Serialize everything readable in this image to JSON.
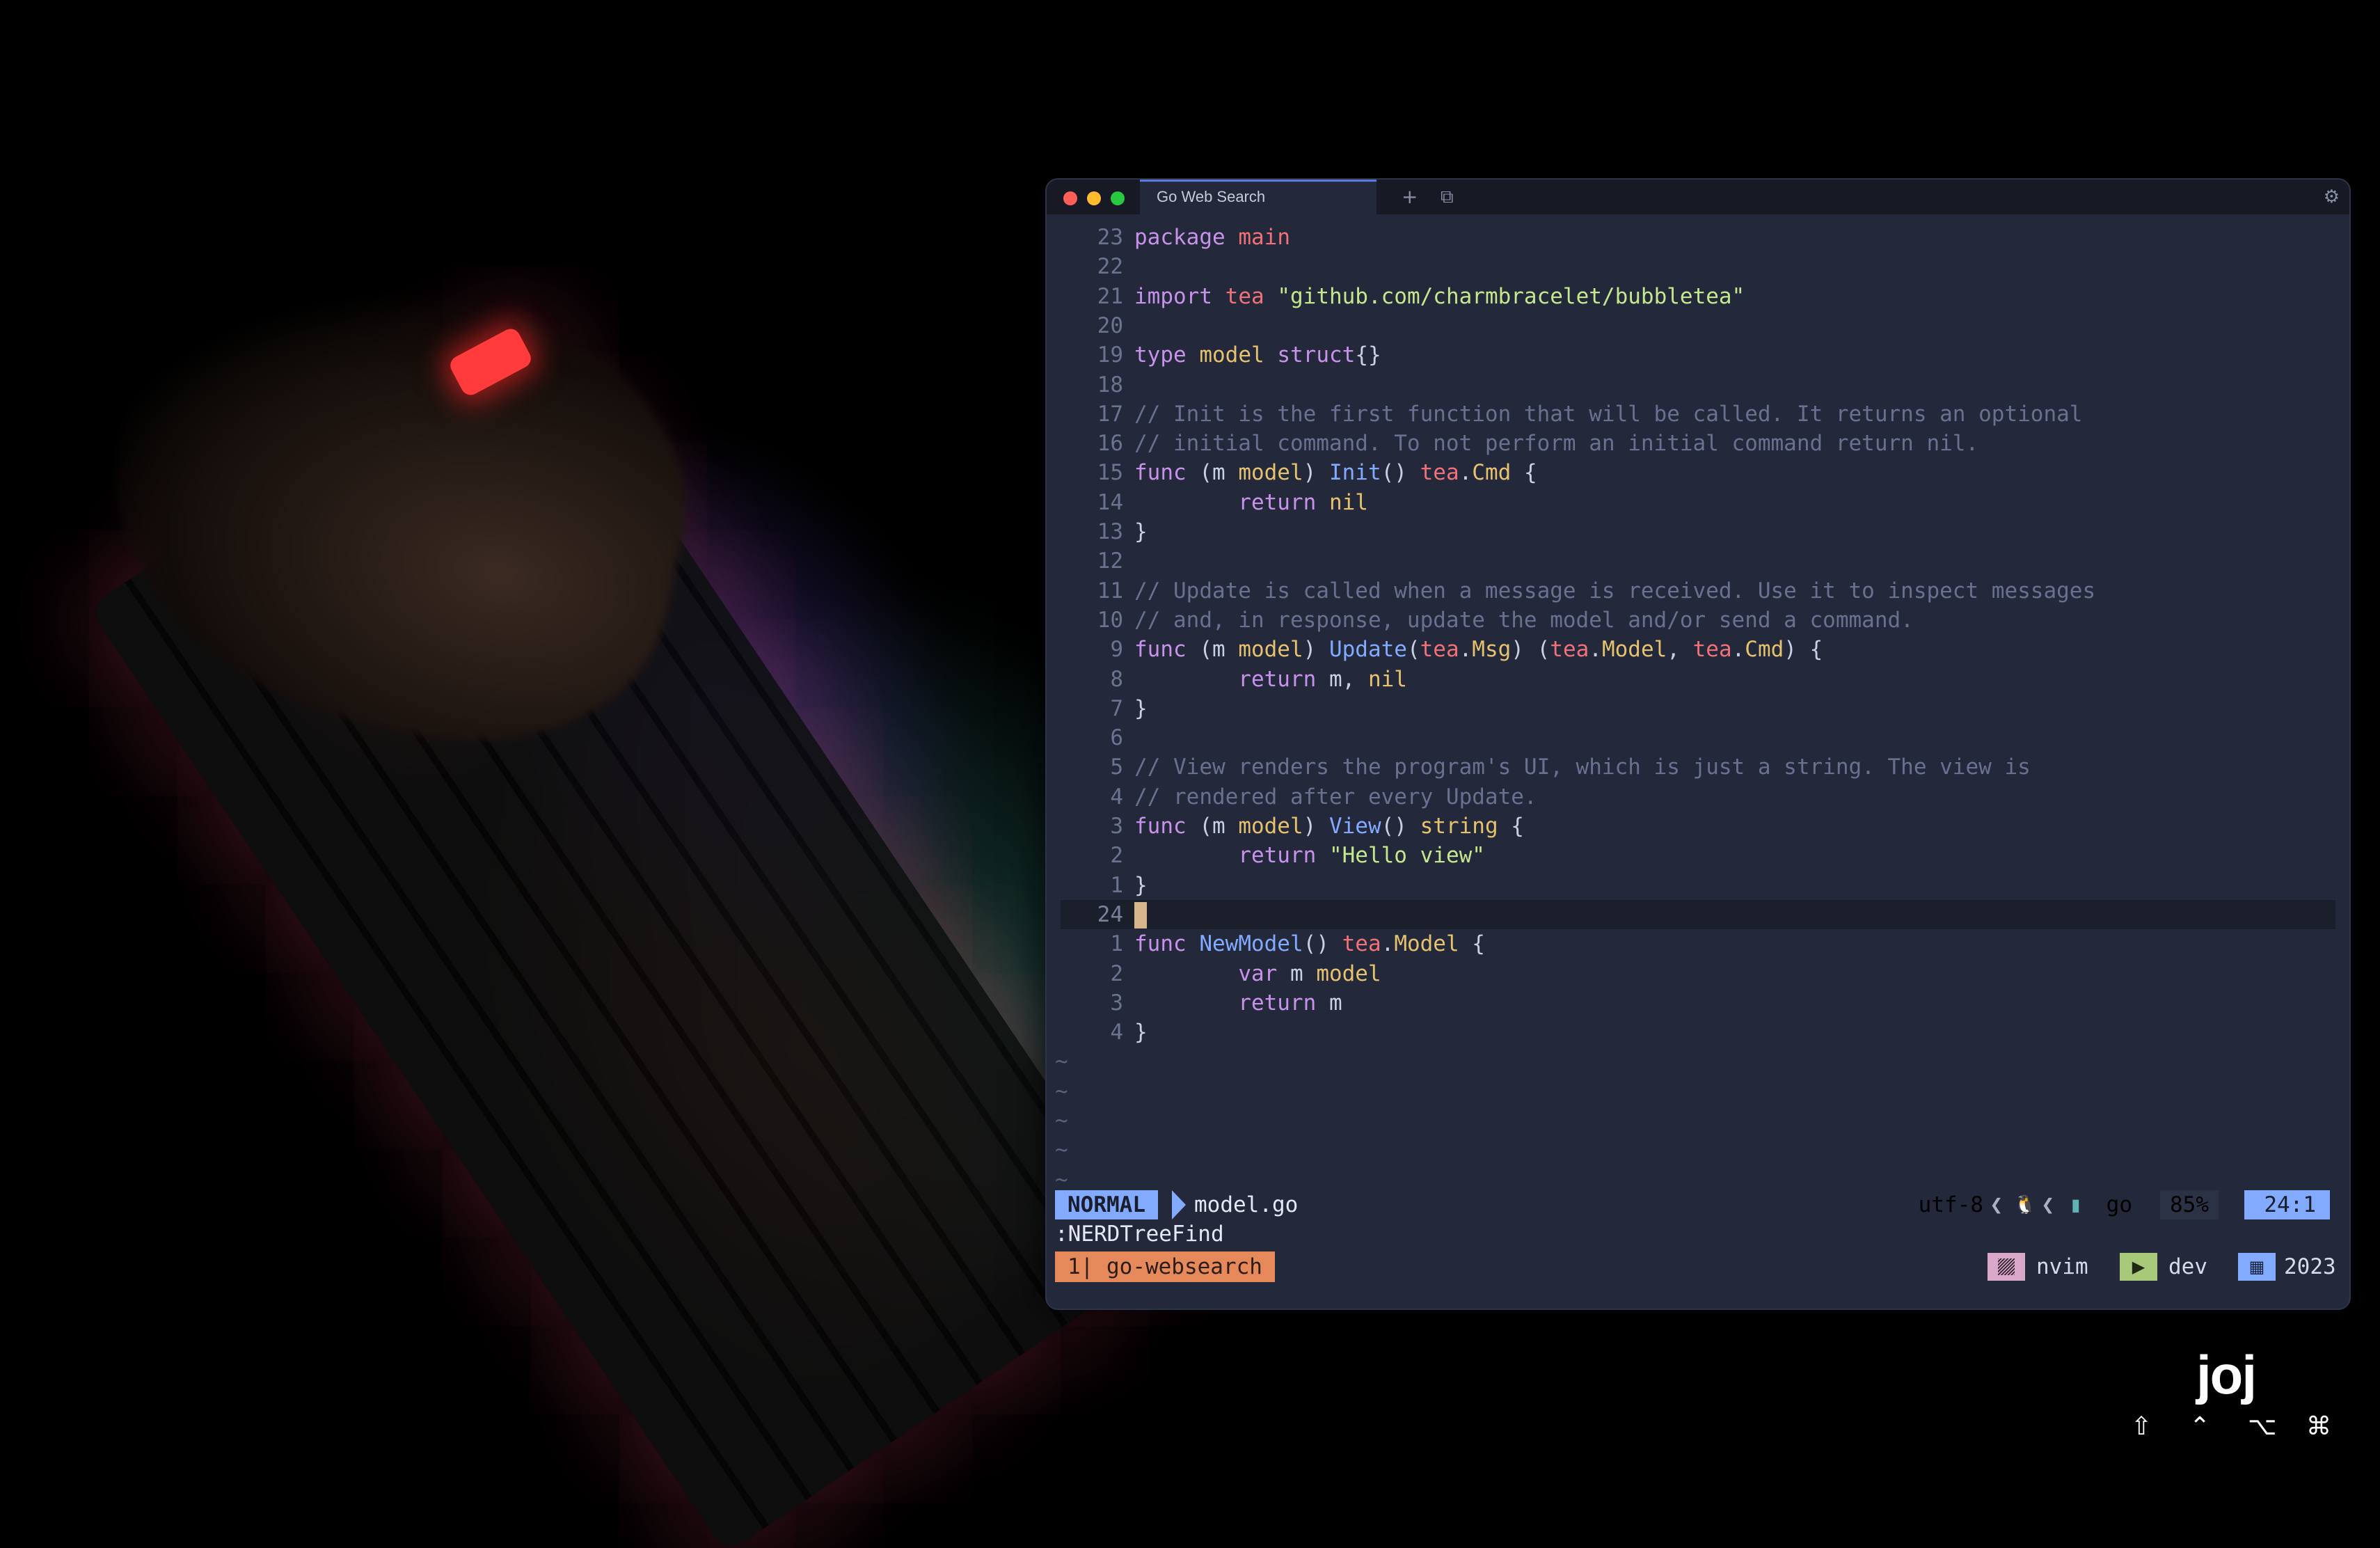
{
  "window": {
    "tab_title": "Go Web Search",
    "new_tab_icon": "+",
    "duplicate_icon": "⧉",
    "settings_icon": "⚙"
  },
  "editor": {
    "lines": [
      {
        "num": "23",
        "html": "<span class=\"kw\">package</span> <span class=\"pk\">main</span>"
      },
      {
        "num": "22",
        "html": ""
      },
      {
        "num": "21",
        "html": "<span class=\"kw\">import</span> <span class=\"pk\">tea</span> <span class=\"st\">\"github.com/charmbracelet/bubbletea\"</span>"
      },
      {
        "num": "20",
        "html": ""
      },
      {
        "num": "19",
        "html": "<span class=\"kw\">type</span> <span class=\"ty\">model</span> <span class=\"kw\">struct</span><span class=\"df\">{}</span>"
      },
      {
        "num": "18",
        "html": ""
      },
      {
        "num": "17",
        "html": "<span class=\"cm\">// Init is the first function that will be called. It returns an optional</span>"
      },
      {
        "num": "16",
        "html": "<span class=\"cm\">// initial command. To not perform an initial command return nil.</span>"
      },
      {
        "num": "15",
        "html": "<span class=\"kw\">func</span> (m <span class=\"ty\">model</span>) <span class=\"fn\">Init</span>() <span class=\"pk\">tea</span>.<span class=\"ty\">Cmd</span> {"
      },
      {
        "num": "14",
        "html": "        <span class=\"kw\">return</span> <span class=\"ty\">nil</span>"
      },
      {
        "num": "13",
        "html": "}"
      },
      {
        "num": "12",
        "html": ""
      },
      {
        "num": "11",
        "html": "<span class=\"cm\">// Update is called when a message is received. Use it to inspect messages</span>"
      },
      {
        "num": "10",
        "html": "<span class=\"cm\">// and, in response, update the model and/or send a command.</span>"
      },
      {
        "num": "9",
        "html": "<span class=\"kw\">func</span> (m <span class=\"ty\">model</span>) <span class=\"fn\">Update</span>(<span class=\"pk\">tea</span>.<span class=\"ty\">Msg</span>) (<span class=\"pk\">tea</span>.<span class=\"ty\">Model</span>, <span class=\"pk\">tea</span>.<span class=\"ty\">Cmd</span>) {"
      },
      {
        "num": "8",
        "html": "        <span class=\"kw\">return</span> m, <span class=\"ty\">nil</span>"
      },
      {
        "num": "7",
        "html": "}"
      },
      {
        "num": "6",
        "html": ""
      },
      {
        "num": "5",
        "html": "<span class=\"cm\">// View renders the program's UI, which is just a string. The view is</span>"
      },
      {
        "num": "4",
        "html": "<span class=\"cm\">// rendered after every Update.</span>"
      },
      {
        "num": "3",
        "html": "<span class=\"kw\">func</span> (m <span class=\"ty\">model</span>) <span class=\"fn\">View</span>() <span class=\"ty\">string</span> {"
      },
      {
        "num": "2",
        "html": "        <span class=\"kw\">return</span> <span class=\"st\">\"Hello view\"</span>"
      },
      {
        "num": "1",
        "html": "}"
      },
      {
        "num": "24",
        "html": "<span class=\"cursor\"></span>",
        "current": true
      },
      {
        "num": "1",
        "html": "<span class=\"kw\">func</span> <span class=\"fn\">NewModel</span>() <span class=\"pk\">tea</span>.<span class=\"ty\">Model</span> {"
      },
      {
        "num": "2",
        "html": "        <span class=\"kw\">var</span> m <span class=\"ty\">model</span>"
      },
      {
        "num": "3",
        "html": "        <span class=\"kw\">return</span> m"
      },
      {
        "num": "4",
        "html": "}"
      }
    ],
    "tilde_count": 5,
    "tilde_char": "~"
  },
  "statusline": {
    "mode": "NORMAL",
    "filename": "model.go",
    "encoding": "utf-8",
    "sep1": "❮",
    "os_icon": "🐧",
    "sep2": "❮",
    "filetype_icon": "▮",
    "filetype": "go",
    "percent": "85%",
    "position": "24:1"
  },
  "cmdline": ":NERDTreeFind",
  "tmux": {
    "window": "1| go-websearch",
    "items": [
      {
        "icon": "🮙",
        "label": "nvim",
        "color": "#d9a7c7",
        "icon_name": "process-icon"
      },
      {
        "icon": "▶",
        "label": "dev",
        "color": "#a9c97a",
        "icon_name": "terminal-icon"
      },
      {
        "icon": "▦",
        "label": "2023",
        "color": "#82aaff",
        "icon_name": "calendar-icon"
      }
    ]
  },
  "overlay": {
    "logo": "joj",
    "modifier_keys": [
      "⇧",
      "⌃",
      "⌥",
      "⌘"
    ]
  }
}
